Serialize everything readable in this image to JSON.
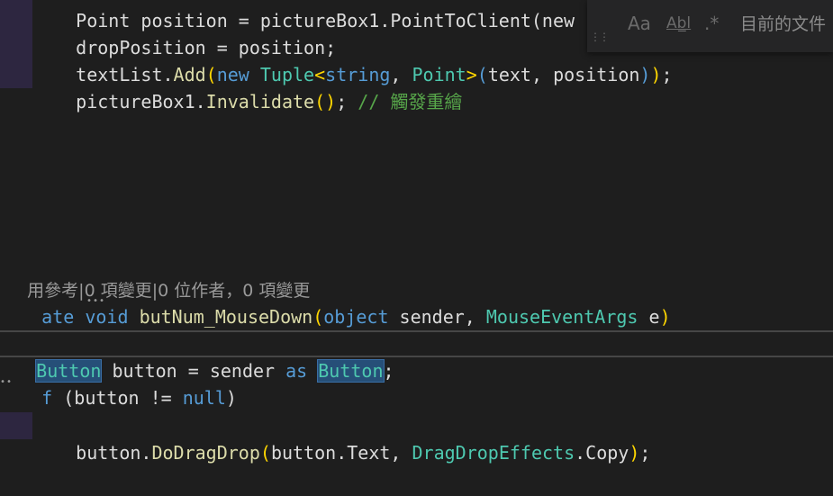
{
  "find_widget": {
    "match_case_label": "Aa",
    "whole_word_label": "Ab̲l",
    "regex_label": ".*",
    "scope_text": "目前的文件"
  },
  "code_lines": {
    "l1": {
      "p1": "dropPosition",
      "p2": " = ",
      "p3": "position",
      "p4": ";"
    },
    "l2": {
      "p1": "textList",
      "p2": ".",
      "p3": "Add",
      "p4": "(",
      "p5": "new",
      "p6": " ",
      "p7": "Tuple",
      "p8": "<",
      "p9": "string",
      "p10": ", ",
      "p11": "Point",
      "p12": ">",
      "p13": "(",
      "p14": "text",
      "p15": ", ",
      "p16": "position",
      "p17": ")",
      "p18": ")",
      "p19": ";"
    },
    "l3": {
      "p1": "pictureBox1",
      "p2": ".",
      "p3": "Invalidate",
      "p4": "()",
      "p5": "; ",
      "p6": "// 觸發重繪"
    },
    "lens": "用參考|0 項變更|0 位作者，0 項變更",
    "l4": {
      "p1": "ate",
      "p2": " ",
      "p3": "void",
      "p4": " ",
      "p5": "butNum_MouseDown",
      "p6": "(",
      "p7": "object",
      "p8": " sender, ",
      "p9": "MouseEventArgs",
      "p10": " e",
      "p11": ")"
    },
    "l5": {
      "p1": "Button",
      "p2": " button = sender ",
      "p3": "as",
      "p4": " ",
      "p5": "Button",
      "p6": ";"
    },
    "l6": {
      "p1": "f",
      "p2": " (button != ",
      "p3": "null",
      "p4": ")"
    },
    "l7": {
      "p1": "button",
      "p2": ".",
      "p3": "DoDragDrop",
      "p4": "(",
      "p5": "button",
      "p6": ".",
      "p7": "Text",
      "p8": ", ",
      "p9": "DragDropEffects",
      "p10": ".",
      "p11": "Copy",
      "p12": ")",
      "p13": ";"
    }
  }
}
